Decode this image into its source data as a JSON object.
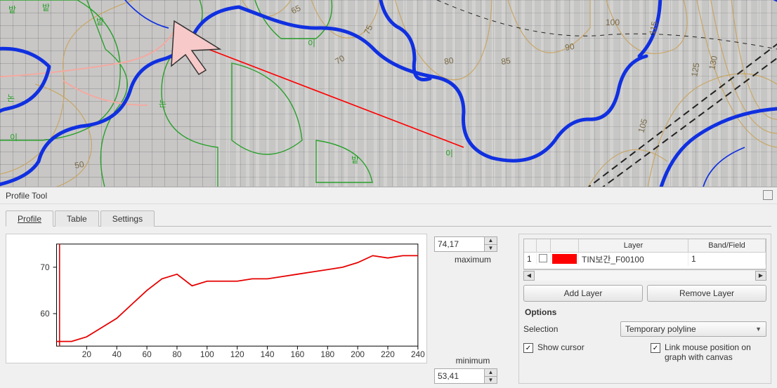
{
  "panel_title": "Profile Tool",
  "tabs": [
    "Profile",
    "Table",
    "Settings"
  ],
  "active_tab": 0,
  "chart_data": {
    "type": "line",
    "x": [
      0,
      10,
      20,
      30,
      40,
      50,
      60,
      70,
      80,
      90,
      100,
      110,
      120,
      130,
      140,
      150,
      160,
      170,
      180,
      190,
      200,
      210,
      220,
      230,
      240
    ],
    "values": [
      54,
      54,
      55,
      57,
      59,
      62,
      65,
      67.5,
      68.5,
      66,
      67,
      67,
      67,
      67.5,
      67.5,
      68,
      68.5,
      69,
      69.5,
      70,
      71,
      72.5,
      72,
      72.5,
      72.5
    ],
    "xlim": [
      0,
      240
    ],
    "ylim": [
      53,
      75
    ],
    "yticks": [
      60,
      70
    ],
    "xticks": [
      20,
      40,
      60,
      80,
      100,
      120,
      140,
      160,
      180,
      200,
      220,
      240
    ],
    "line_color": "#e60000"
  },
  "max_value": "74,17",
  "max_label": "maximum",
  "min_value": "53,41",
  "min_label": "minimum",
  "layer_headers": {
    "c0": "",
    "c1": "",
    "c2": "",
    "c3": "Layer",
    "c4": "Band/Field"
  },
  "layer_row": {
    "idx": "1",
    "layer": "TIN보간_F00100",
    "band": "1",
    "swatch": "#ff0000"
  },
  "btn_add": "Add Layer",
  "btn_remove": "Remove Layer",
  "options_head": "Options",
  "selection_label": "Selection",
  "selection_value": "Temporary polyline",
  "show_cursor": "Show cursor",
  "link_mouse": "Link mouse position on graph with canvas",
  "map_contours": [
    "50",
    "65",
    "70",
    "75",
    "80",
    "85",
    "90",
    "100",
    "105",
    "115",
    "125",
    "130"
  ],
  "map_labels": [
    "밭",
    "밭",
    "밭",
    "논",
    "논",
    "밭",
    "이",
    "이",
    "이"
  ]
}
